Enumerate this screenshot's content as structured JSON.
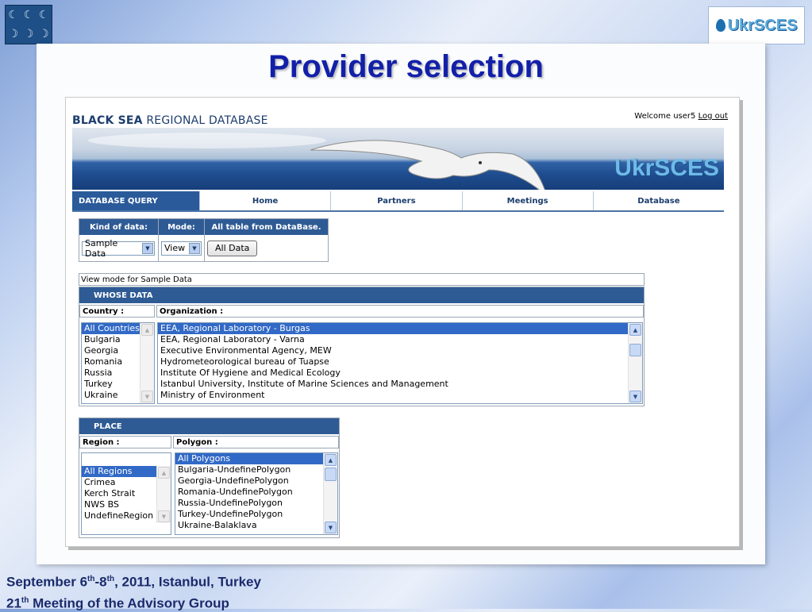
{
  "slide": {
    "title": "Provider selection",
    "footer_date_prefix": "September 6",
    "footer_sup1": "th",
    "footer_date_mid": "-8",
    "footer_sup2": "th",
    "footer_date_suffix": ", 2011, Istanbul, Turkey",
    "footer_meeting_num": "21",
    "footer_sup3": "th",
    "footer_meeting_text": " Meeting of the Advisory Group",
    "right_logo": "UkrSCES"
  },
  "site": {
    "title_bold": "BLACK SEA",
    "title_rest": " REGIONAL DATABASE",
    "welcome": "Welcome user5",
    "logout": "Log out",
    "banner_logo": "UkrSCES"
  },
  "nav": {
    "active": "DATABASE QUERY",
    "items": [
      "Home",
      "Partners",
      "Meetings",
      "Database"
    ]
  },
  "controls": {
    "kind_label": "Kind of data:",
    "kind_value": "Sample Data",
    "mode_label": "Mode:",
    "mode_value": "View",
    "all_label": "All table from DataBase.",
    "all_button": "All Data"
  },
  "view_mode": "View mode for Sample Data",
  "whose": {
    "title": "WHOSE DATA",
    "country_label": "Country :",
    "org_label": "Organization :",
    "countries": [
      "All Countries",
      "Bulgaria",
      "Georgia",
      "Romania",
      "Russia",
      "Turkey",
      "Ukraine"
    ],
    "organizations": [
      "EEA, Regional Laboratory - Burgas",
      "EEA, Regional Laboratory - Varna",
      "Executive Environmental Agency, MEW",
      "Hydrometeorological bureau of Tuapse",
      "Institute Of Hygiene and Medical Ecology",
      "Istanbul University, Institute of Marine Sciences and Management",
      "Ministry of Environment"
    ]
  },
  "place": {
    "title": "PLACE",
    "region_label": "Region :",
    "polygon_label": "Polygon :",
    "regions": [
      "All Regions",
      "Crimea",
      "Kerch Strait",
      "NWS BS",
      "UndefineRegion"
    ],
    "polygons": [
      "All Polygons",
      "Bulgaria-UndefinePolygon",
      "Georgia-UndefinePolygon",
      "Romania-UndefinePolygon",
      "Russia-UndefinePolygon",
      "Turkey-UndefinePolygon",
      "Ukraine-Balaklava"
    ]
  }
}
